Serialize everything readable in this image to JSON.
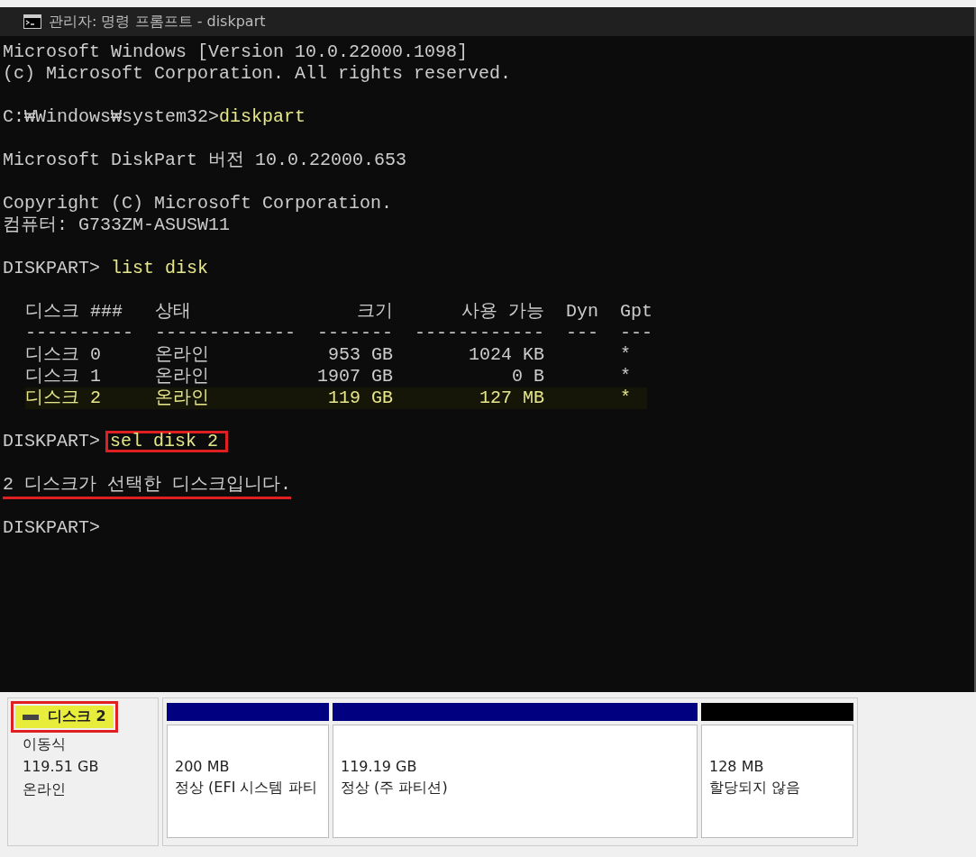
{
  "window": {
    "title": "관리자: 명령 프롬프트 - diskpart"
  },
  "console": {
    "lines": [
      {
        "kind": "output",
        "text": "Microsoft Windows [Version 10.0.22000.1098]"
      },
      {
        "kind": "output",
        "text": "(c) Microsoft Corporation. All rights reserved."
      },
      {
        "kind": "blank"
      },
      {
        "kind": "command",
        "prompt": "C:₩Windows₩system32>",
        "command": "diskpart"
      },
      {
        "kind": "blank"
      },
      {
        "kind": "output",
        "text": "Microsoft DiskPart 버전 10.0.22000.653"
      },
      {
        "kind": "blank"
      },
      {
        "kind": "output",
        "text": "Copyright (C) Microsoft Corporation."
      },
      {
        "kind": "output",
        "text": "컴퓨터: G733ZM-ASUSW11"
      },
      {
        "kind": "blank"
      },
      {
        "kind": "command",
        "prompt": "DISKPART> ",
        "command": "list disk"
      },
      {
        "kind": "blank"
      },
      {
        "kind": "table"
      },
      {
        "kind": "blank"
      },
      {
        "kind": "command",
        "prompt": "DISKPART> ",
        "command": "sel disk 2",
        "boxed": true
      },
      {
        "kind": "blank"
      },
      {
        "kind": "message",
        "text": "2 디스크가 선택한 디스크입니다.",
        "underlined": true
      },
      {
        "kind": "blank"
      },
      {
        "kind": "command",
        "prompt": "DISKPART>"
      }
    ]
  },
  "disk_table": {
    "columns": [
      "디스크 ###",
      "상태",
      "크기",
      "사용 가능",
      "Dyn",
      "Gpt"
    ],
    "separators": [
      "----------",
      "-------------",
      "-------",
      "------------",
      "---",
      "---"
    ],
    "rows": [
      {
        "cells": [
          "디스크 0",
          "온라인",
          "953 GB",
          "1024 KB",
          "",
          "*"
        ],
        "selected": false
      },
      {
        "cells": [
          "디스크 1",
          "온라인",
          "1907 GB",
          "0 B",
          "",
          "*"
        ],
        "selected": false
      },
      {
        "cells": [
          "디스크 2",
          "온라인",
          "119 GB",
          "127 MB",
          "",
          "*"
        ],
        "selected": true
      }
    ]
  },
  "disk_manager": {
    "disk": {
      "name": "디스크 2",
      "highlighted": true,
      "type": "이동식",
      "size": "119.51 GB",
      "status": "온라인"
    },
    "partitions": [
      {
        "size": "200 MB",
        "status": "정상 (EFI 시스템 파티",
        "kind": "primary"
      },
      {
        "size": "119.19 GB",
        "status": "정상 (주 파티션)",
        "kind": "primary"
      },
      {
        "size": "128 MB",
        "status": "할당되지 않음",
        "kind": "unallocated"
      }
    ]
  }
}
